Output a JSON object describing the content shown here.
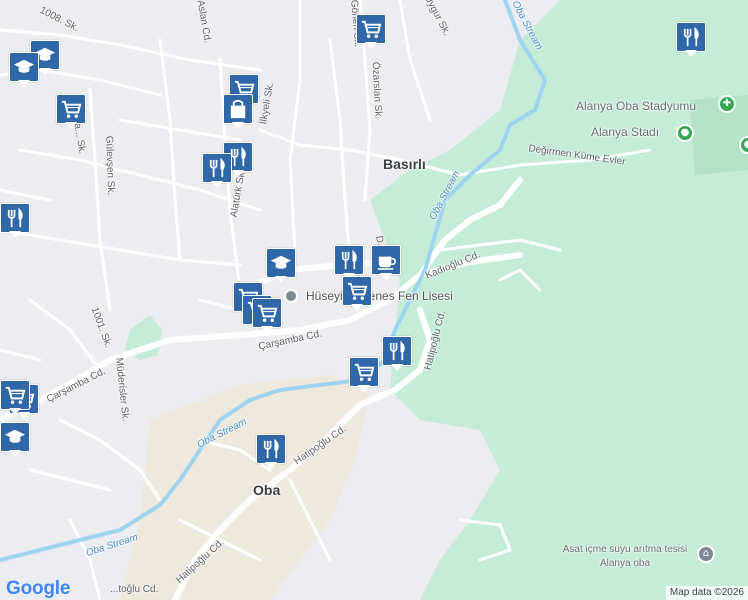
{
  "colors": {
    "land": "#ecedf1",
    "park": "#c4ecd7",
    "built": "#eee9dc",
    "road": "#ffffff",
    "water": "#9fd4f0",
    "marker": "#3067a8"
  },
  "places": {
    "basirli": "Basırlı",
    "oba": "Oba"
  },
  "pois": {
    "stadium_1": "Alanya Oba Stadyumu",
    "stadium_2": "Alanya Stadı",
    "school": "Hüseyin Girenes Fen Lisesi",
    "plant": "Asat içme suyu arıtma tesisi Alanya oba"
  },
  "streets": {
    "s1008": "1008. Sk.",
    "aslan": "Aslan Cd.",
    "gonen": "Gönen Sk.",
    "uygur": "Uygur Sk.",
    "ozarslan": "Özarslan Sk.",
    "ilkyeli": "İlkyeli Sk.",
    "basi": "Ba... Sk.",
    "gulevsen": "Gülevşen Sk.",
    "alaturk": "Alatürk Sk.",
    "degirmen": "Değirmen Küme Evler",
    "kadioglu": "Kadıoğlu Cd.",
    "d_short": "D...",
    "s1001": "1001. Sk.",
    "carsamba_1": "Çarşamba Cd.",
    "carsamba_2": "Çarşamba Cd.",
    "mudersler": "Müderisler Sk.",
    "hatipoglu_v": "Hatipoğlu Cd.",
    "hatipoglu_1": "Hatipoğlu Cd.",
    "hatipoglu_2": "Hatipoğlu Cd.",
    "hatipoglu_3": "...toğlu Cd."
  },
  "water_labels": {
    "w1": "Oba Stream",
    "w2": "Oba Stream",
    "w3": "Oba Stream",
    "w4": "Oba Stream"
  },
  "markers": [
    {
      "icon": "mortarboard-icon"
    },
    {
      "icon": "coffee-icon"
    },
    {
      "icon": "shopping-cart-icon"
    },
    {
      "icon": "restaurant-icon"
    },
    {
      "icon": "shopping-cart-icon"
    },
    {
      "icon": "restaurant-icon"
    },
    {
      "icon": "shopping-cart-icon"
    },
    {
      "icon": "shopping-cart-icon"
    },
    {
      "icon": "shopping-bag-icon"
    },
    {
      "icon": "restaurant-icon"
    },
    {
      "icon": "restaurant-icon"
    },
    {
      "icon": "restaurant-icon"
    },
    {
      "icon": "mortarboard-icon"
    },
    {
      "icon": "shopping-cart-icon"
    },
    {
      "icon": "shopping-cart-icon"
    },
    {
      "icon": "shopping-cart-icon"
    },
    {
      "icon": "restaurant-icon"
    },
    {
      "icon": "shopping-cart-icon"
    },
    {
      "icon": "restaurant-icon"
    },
    {
      "icon": "shopping-cart-icon"
    },
    {
      "icon": "mortarboard-icon"
    },
    {
      "icon": "mortarboard-icon"
    },
    {
      "icon": "shopping-cart-icon"
    }
  ],
  "attribution": {
    "logo_text": "Google",
    "map_data": "Map data ©2026"
  }
}
